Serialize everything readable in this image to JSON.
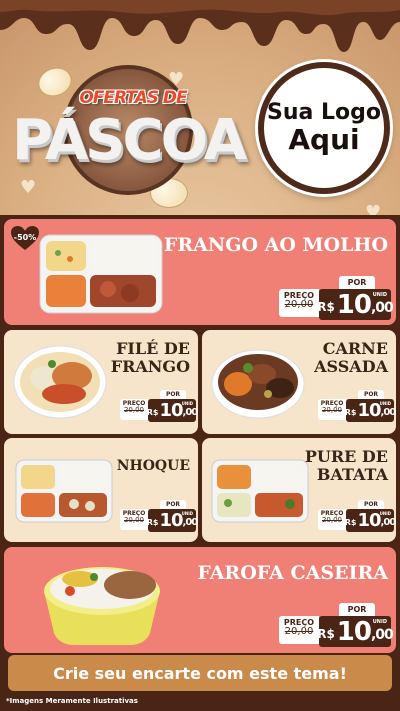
{
  "header": {
    "title_top": "OFERTAS DE",
    "title_main": "PÁSCOA",
    "logo_line1": "Sua Logo",
    "logo_line2": "Aqui"
  },
  "colors": {
    "chocolate": "#4a2516",
    "pink": "#f07f76",
    "cream": "#f6e4cb",
    "cta": "#c98a4a"
  },
  "price_labels": {
    "por": "POR",
    "preco": "PREÇO",
    "rs": "R$",
    "unid": "UNID"
  },
  "products": [
    {
      "name_lines": [
        "FRANGO AO MOLHO"
      ],
      "discount": "-50%",
      "old_price": "20,00",
      "price_int": "10",
      "price_dec": ",00",
      "icon": "marmita-frango-molho"
    },
    {
      "name_lines": [
        "FILÉ DE",
        "FRANGO"
      ],
      "old_price": "20,00",
      "price_int": "10",
      "price_dec": ",00",
      "icon": "bowl-file-frango"
    },
    {
      "name_lines": [
        "CARNE",
        "ASSADA"
      ],
      "old_price": "20,00",
      "price_int": "10",
      "price_dec": ",00",
      "icon": "bowl-carne-assada"
    },
    {
      "name_lines": [
        "NHOQUE"
      ],
      "old_price": "20,00",
      "price_int": "10",
      "price_dec": ",00",
      "icon": "marmita-nhoque"
    },
    {
      "name_lines": [
        "PURE DE",
        "BATATA"
      ],
      "old_price": "20,00",
      "price_int": "10",
      "price_dec": ",00",
      "icon": "marmita-pure-batata"
    },
    {
      "name_lines": [
        "FAROFA CASEIRA"
      ],
      "old_price": "20,00",
      "price_int": "10",
      "price_dec": ",00",
      "icon": "bowl-farofa"
    }
  ],
  "cta": {
    "label": "Crie seu encarte com este tema!"
  },
  "disclaimer": "*Imagens Meramente Ilustrativas"
}
